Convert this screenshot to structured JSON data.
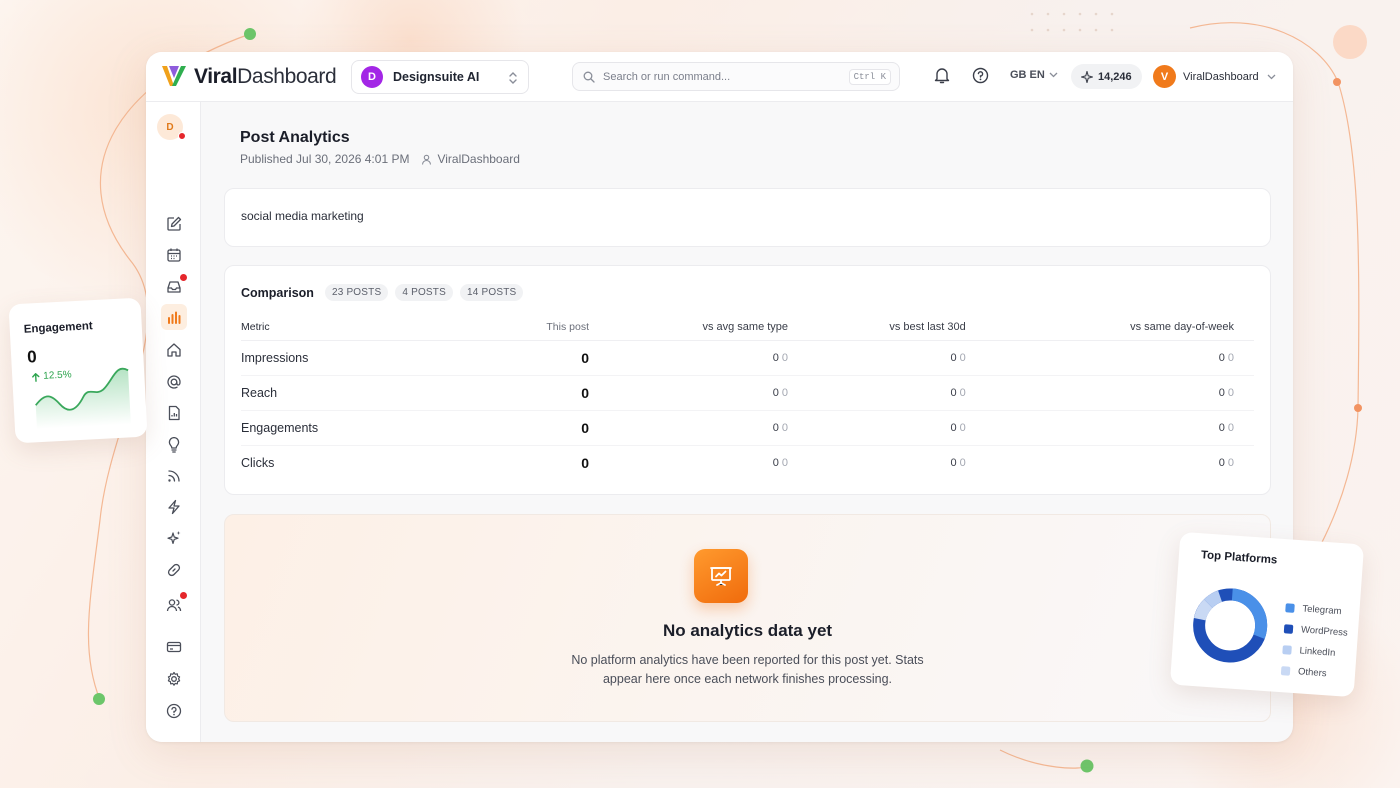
{
  "brand": {
    "part1": "Viral",
    "part2": "Dashboard"
  },
  "workspace": {
    "initial": "D",
    "name": "Designsuite AI"
  },
  "search": {
    "placeholder": "Search or run command...",
    "shortcut": "Ctrl K"
  },
  "topbar": {
    "language": "GB EN",
    "credits": "14,246",
    "user_initial": "V",
    "user_name": "ViralDashboard"
  },
  "rail": {
    "avatar_initial": "D",
    "items": [
      {
        "icon": "edit-icon",
        "active": false,
        "badge": false
      },
      {
        "icon": "calendar-icon",
        "active": false,
        "badge": false
      },
      {
        "icon": "inbox-icon",
        "active": false,
        "badge": true
      },
      {
        "icon": "bar-chart-icon",
        "active": true,
        "badge": false
      },
      {
        "icon": "home-icon",
        "active": false,
        "badge": false
      },
      {
        "icon": "at-sign-icon",
        "active": false,
        "badge": false
      },
      {
        "icon": "document-icon",
        "active": false,
        "badge": false
      },
      {
        "icon": "lightbulb-icon",
        "active": false,
        "badge": false
      },
      {
        "icon": "rss-icon",
        "active": false,
        "badge": false
      },
      {
        "icon": "lightning-icon",
        "active": false,
        "badge": false
      },
      {
        "icon": "sparkles-icon",
        "active": false,
        "badge": false
      },
      {
        "icon": "link-icon",
        "active": false,
        "badge": false
      },
      {
        "icon": "users-icon",
        "active": false,
        "badge": true
      },
      {
        "icon": "card-icon",
        "active": false,
        "badge": false
      },
      {
        "icon": "settings-icon",
        "active": false,
        "badge": false
      },
      {
        "icon": "help-icon",
        "active": false,
        "badge": false
      }
    ]
  },
  "post": {
    "title": "Post Analytics",
    "published": "Published Jul 30, 2026 4:01 PM",
    "author": "ViralDashboard",
    "topic": "social media marketing"
  },
  "comparison": {
    "title": "Comparison",
    "chips": [
      "23 POSTS",
      "4 POSTS",
      "14 POSTS"
    ],
    "headers": [
      "Metric",
      "This post",
      "vs avg same type",
      "vs best last 30d",
      "vs same day-of-week"
    ],
    "rows": [
      {
        "metric": "Impressions",
        "this": "0",
        "vs": [
          [
            "0",
            "0"
          ],
          [
            "0",
            "0"
          ],
          [
            "0",
            "0"
          ]
        ]
      },
      {
        "metric": "Reach",
        "this": "0",
        "vs": [
          [
            "0",
            "0"
          ],
          [
            "0",
            "0"
          ],
          [
            "0",
            "0"
          ]
        ]
      },
      {
        "metric": "Engagements",
        "this": "0",
        "vs": [
          [
            "0",
            "0"
          ],
          [
            "0",
            "0"
          ],
          [
            "0",
            "0"
          ]
        ]
      },
      {
        "metric": "Clicks",
        "this": "0",
        "vs": [
          [
            "0",
            "0"
          ],
          [
            "0",
            "0"
          ],
          [
            "0",
            "0"
          ]
        ]
      }
    ]
  },
  "empty_state": {
    "title": "No analytics data yet",
    "line1": "No platform analytics have been reported for this post yet. Stats",
    "line2": "appear here once each network finishes processing."
  },
  "engagement_widget": {
    "title": "Engagement",
    "value": "0",
    "delta": "12.5%"
  },
  "platforms_widget": {
    "title": "Top Platforms",
    "items": [
      {
        "name": "Telegram",
        "color": "#4a90e8"
      },
      {
        "name": "WordPress",
        "color": "#1f4fb8"
      },
      {
        "name": "LinkedIn",
        "color": "#b8cef2"
      },
      {
        "name": "Others",
        "color": "#c9d9f4"
      }
    ]
  },
  "colors": {
    "accent": "#f07a1b",
    "success": "#2da44e",
    "notify": "#e5262b"
  }
}
